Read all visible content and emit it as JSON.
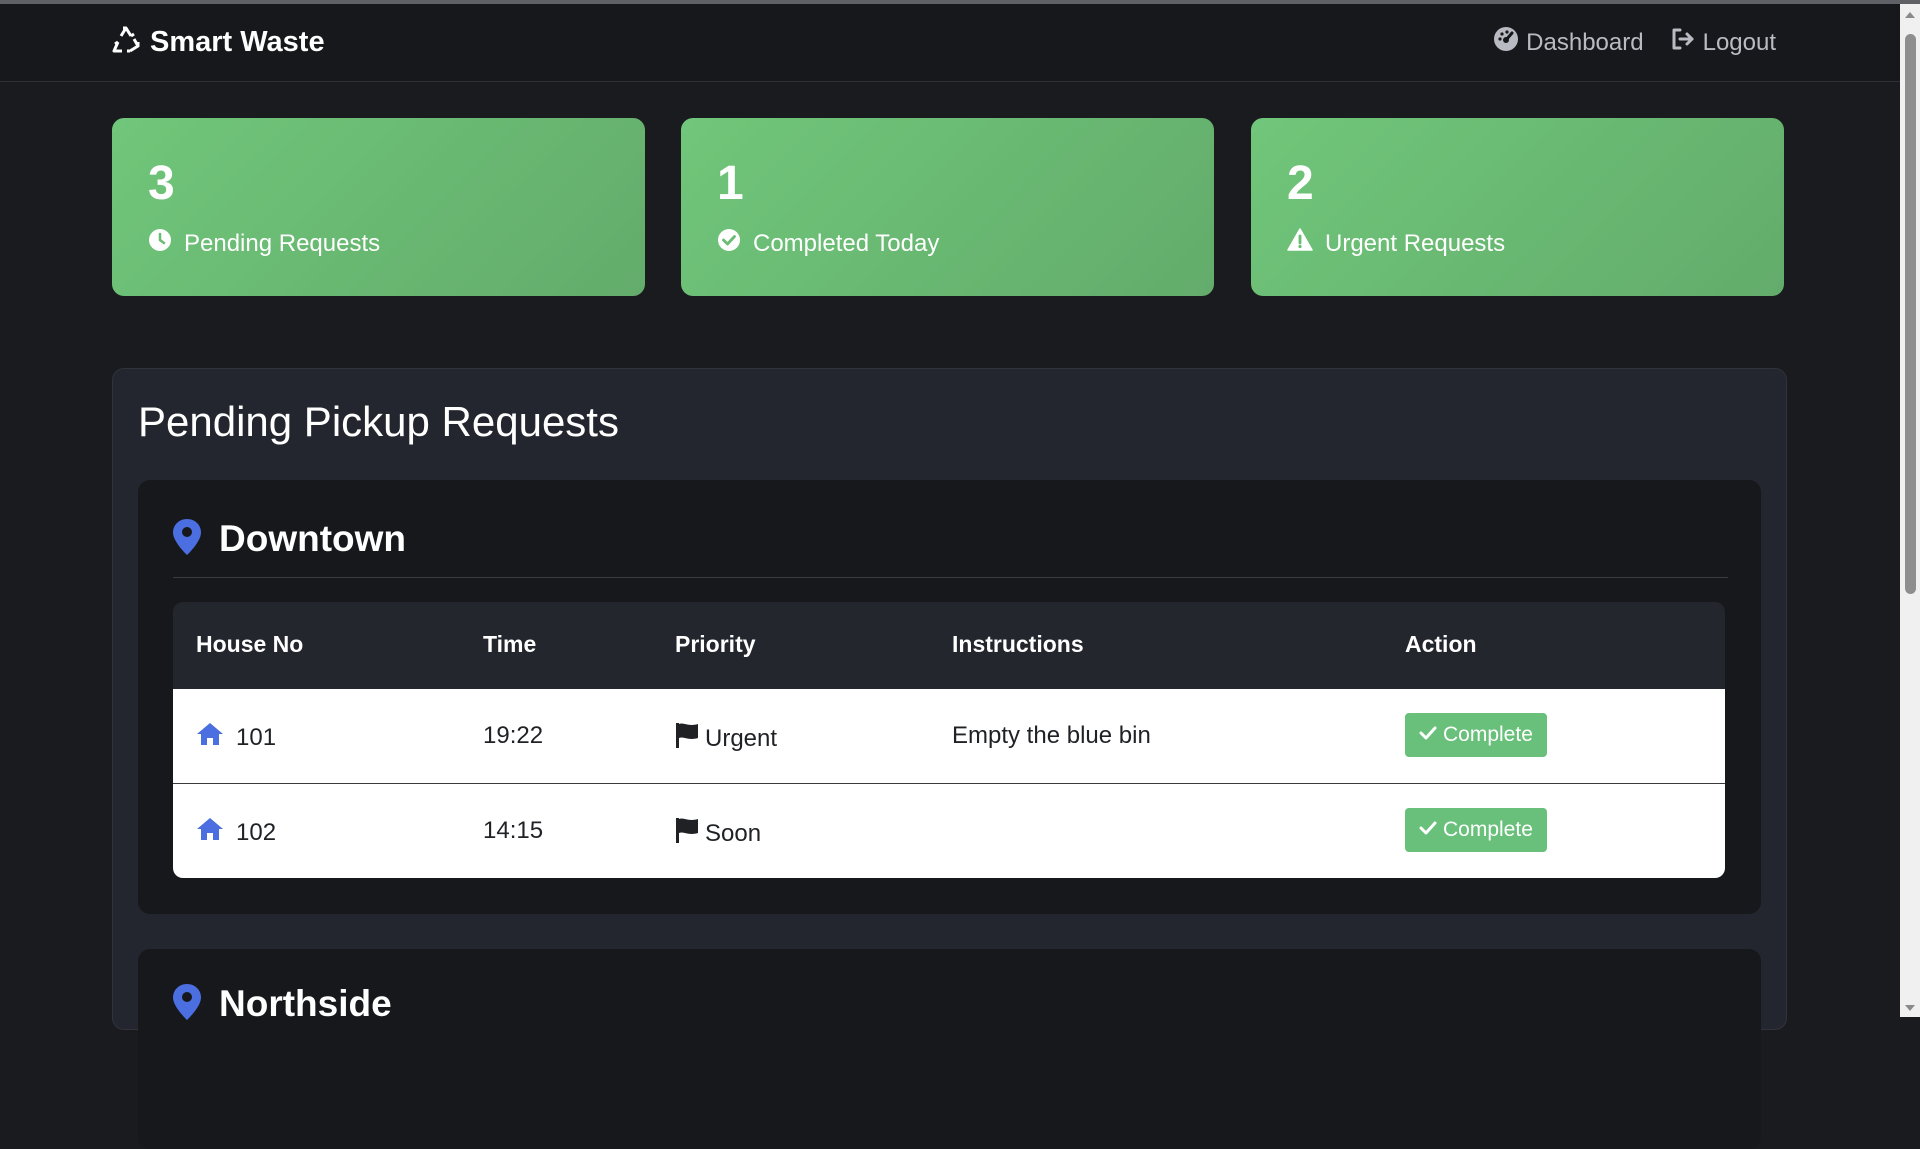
{
  "navbar": {
    "brand": "Smart Waste",
    "brand_icon": "recycle-icon",
    "links": [
      {
        "label": "Dashboard",
        "icon": "gauge-icon"
      },
      {
        "label": "Logout",
        "icon": "logout-icon"
      }
    ]
  },
  "stats": [
    {
      "value": "3",
      "label": "Pending Requests",
      "icon": "clock-icon"
    },
    {
      "value": "1",
      "label": "Completed Today",
      "icon": "check-circle-icon"
    },
    {
      "value": "2",
      "label": "Urgent Requests",
      "icon": "warning-icon"
    }
  ],
  "main": {
    "title": "Pending Pickup Requests",
    "areas": [
      {
        "name": "Downtown",
        "columns": [
          "House No",
          "Time",
          "Priority",
          "Instructions",
          "Action"
        ],
        "rows": [
          {
            "house": "101",
            "time": "19:22",
            "priority": "Urgent",
            "instructions": "Empty the blue bin",
            "action": "Complete"
          },
          {
            "house": "102",
            "time": "14:15",
            "priority": "Soon",
            "instructions": "",
            "action": "Complete"
          }
        ]
      },
      {
        "name": "Northside"
      }
    ]
  },
  "colors": {
    "background": "#1a1b1e",
    "card_green": "#6abb73",
    "accent_blue": "#4b6ee0",
    "button_green": "#68c07a"
  }
}
